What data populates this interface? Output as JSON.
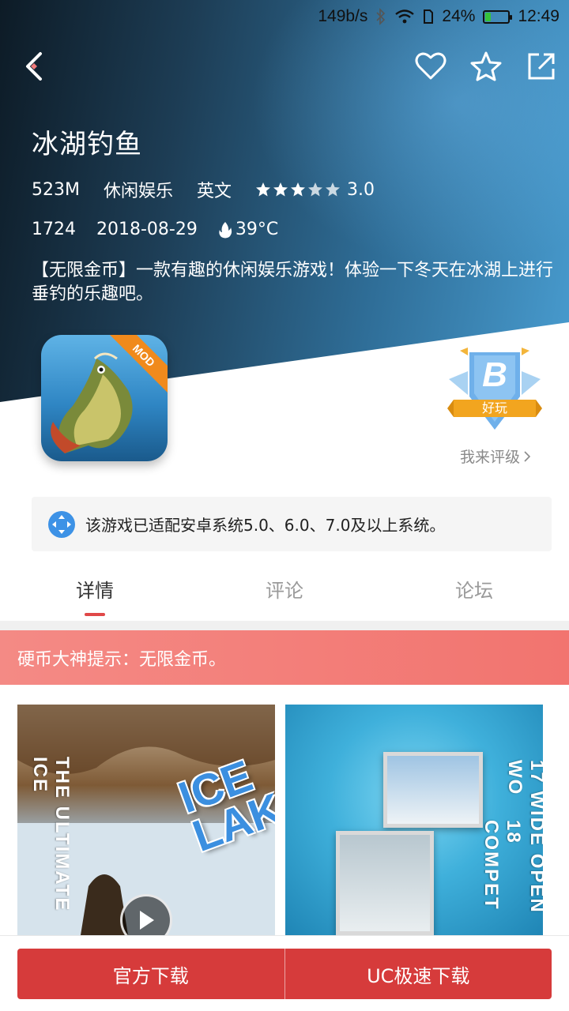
{
  "status_bar": {
    "speed": "149b/s",
    "battery_percent": "24%",
    "battery_level": 0.24,
    "time": "12:49",
    "icons": [
      "bluetooth-icon",
      "wifi-icon",
      "sim-icon",
      "battery-icon"
    ]
  },
  "toolbar": {
    "icons": [
      "back-icon",
      "heart-icon",
      "star-icon",
      "share-icon"
    ]
  },
  "app": {
    "title": "冰湖钓鱼",
    "size": "523M",
    "category": "休闲娱乐",
    "language": "英文",
    "rating_value": "3.0",
    "rating_stars": 3,
    "downloads": "1724",
    "date": "2018-08-29",
    "temperature": "39°C",
    "description": "【无限金币】一款有趣的休闲娱乐游戏！体验一下冬天在冰湖上进行垂钓的乐趣吧。",
    "icon_badge": "MOD"
  },
  "grade_badge": {
    "grade": "B",
    "label": "好玩",
    "rate_link": "我来评级"
  },
  "compat_notice": {
    "text": "该游戏已适配安卓系统5.0、6.0、7.0及以上系统。"
  },
  "tabs": [
    {
      "label": "详情",
      "active": true
    },
    {
      "label": "评论",
      "active": false
    },
    {
      "label": "论坛",
      "active": false
    }
  ],
  "tip": {
    "text": "硬币大神提示：无限金币。"
  },
  "screenshots": [
    {
      "text_vertical": "THE ULTIMATE ICE",
      "logo_line1": "ICE",
      "logo_line2": "LAKES"
    },
    {
      "text_vertical_1": "17 WIDE OPEN WO",
      "text_vertical_2": "18 COMPET"
    }
  ],
  "download": {
    "official_label": "官方下载",
    "uc_label": "UC极速下载"
  },
  "colors": {
    "accent_red": "#d63b3b",
    "tip_bg": "#f2746f",
    "tab_indicator": "#e04848"
  }
}
